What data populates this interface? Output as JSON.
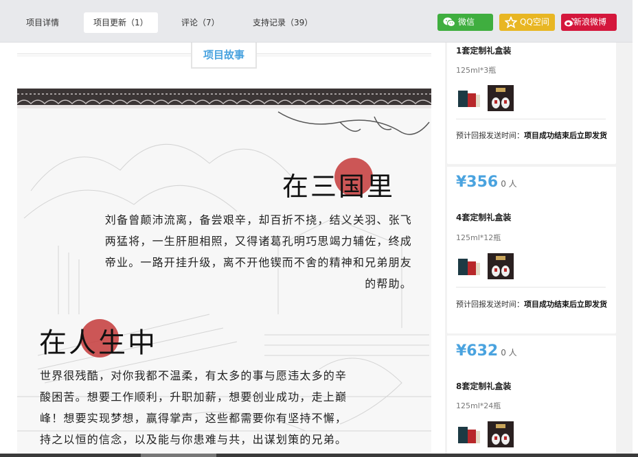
{
  "tabs": [
    {
      "label": "项目详情",
      "active": false
    },
    {
      "label": "项目更新（1）",
      "active": true
    },
    {
      "label": "评论（7）",
      "active": false
    },
    {
      "label": "支持记录（39）",
      "active": false
    }
  ],
  "share": {
    "wechat": {
      "label": "微信",
      "color": "#3fae3f"
    },
    "qzone": {
      "label": "QQ空间",
      "color": "#e8b623"
    },
    "weibo": {
      "label": "新浪微博",
      "color": "#d4173c"
    }
  },
  "story": {
    "tab_label": "项目故事",
    "heading1": "在三国里",
    "para1": [
      "刘备曾颠沛流离，备尝艰辛，却百折不挠，结义关羽、张飞",
      "两猛将，一生肝胆相照，又得诸葛孔明巧思竭力辅佐，终成",
      "帝业。一路开挂升级，离不开他锲而不舍的精神和兄弟朋友",
      "的帮助。"
    ],
    "heading2": "在人生中",
    "para2": [
      "世界很残酷，对你我都不温柔，有太多的事与愿违太多的辛",
      "酸困苦。想要工作顺利，升职加薪，想要创业成功，走上巅",
      "峰！想要实现梦想，赢得掌声，这些都需要你有坚持不懈，",
      "持之以恒的信念，以及能与你患难与共，出谋划策的兄弟。"
    ]
  },
  "rewards": [
    {
      "title": "1套定制礼盒装",
      "spec": "125ml*3瓶",
      "ship_prefix": "预计回报发送时间：",
      "ship_value": "项目成功结束后立即发货"
    },
    {
      "price": "¥356",
      "people": "0 人",
      "title": "4套定制礼盒装",
      "spec": "125ml*12瓶",
      "ship_prefix": "预计回报发送时间：",
      "ship_value": "项目成功结束后立即发货"
    },
    {
      "price": "¥632",
      "people": "0 人",
      "title": "8套定制礼盒装",
      "spec": "125ml*24瓶"
    }
  ]
}
